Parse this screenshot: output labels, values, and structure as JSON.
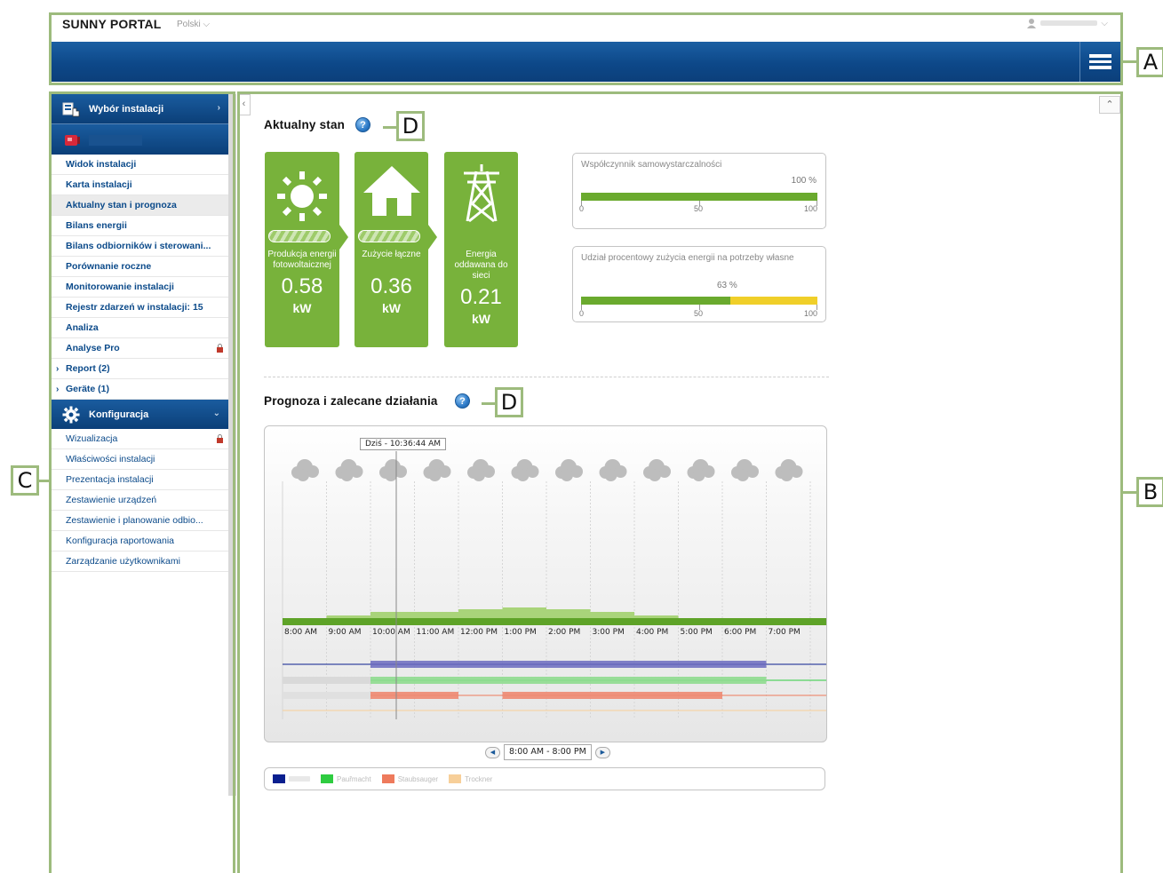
{
  "header": {
    "brand": "SUNNY PORTAL",
    "language": "Polski ⌵",
    "user_chevron": "⌵",
    "menu_icon": "list-menu-icon"
  },
  "sidebar": {
    "plant_selection": "Wybór instalacji",
    "items": [
      {
        "label": "Widok instalacji"
      },
      {
        "label": "Karta instalacji"
      },
      {
        "label": "Aktualny stan i prognoza"
      },
      {
        "label": "Bilans energii"
      },
      {
        "label": "Bilans odbiorników i sterowani..."
      },
      {
        "label": "Porównanie roczne"
      },
      {
        "label": "Monitorowanie instalacji"
      },
      {
        "label": "Rejestr zdarzeń w instalacji: 15"
      },
      {
        "label": "Analiza"
      },
      {
        "label": "Analyse Pro"
      }
    ],
    "expandables": [
      {
        "label": "Report (2)"
      },
      {
        "label": "Geräte (1)"
      }
    ],
    "config_title": "Konfiguracja",
    "config_items": [
      {
        "label": "Wizualizacja"
      },
      {
        "label": "Właściwości instalacji"
      },
      {
        "label": "Prezentacja instalacji"
      },
      {
        "label": "Zestawienie urządzeń"
      },
      {
        "label": "Zestawienie i planowanie odbio..."
      },
      {
        "label": "Konfiguracja raportowania"
      },
      {
        "label": "Zarządzanie użytkownikami"
      }
    ]
  },
  "current_status": {
    "title": "Aktualny stan",
    "tiles": [
      {
        "label": "Produkcja energii fotowoltaicznej",
        "value": "0.58",
        "unit": "kW",
        "icon": "sun-icon"
      },
      {
        "label": "Zużycie łączne",
        "value": "0.36",
        "unit": "kW",
        "icon": "house-icon"
      },
      {
        "label": "Energia oddawana do sieci",
        "value": "0.21",
        "unit": "kW",
        "icon": "power-pylon-icon"
      }
    ],
    "gauges": [
      {
        "title": "Współczynnik samowystarczalności",
        "percent_label": "100 %",
        "green_fraction": 1.0,
        "ticks": [
          "0",
          "50",
          "100"
        ]
      },
      {
        "title": "Udział procentowy zużycia energii na potrzeby własne",
        "percent_label": "63 %",
        "green_fraction": 0.63,
        "ticks": [
          "0",
          "50",
          "100"
        ]
      }
    ]
  },
  "forecast": {
    "title": "Prognoza i zalecane działania",
    "now_label": "Dziś - 10:36:44 AM",
    "hours": [
      "8:00 AM",
      "9:00 AM",
      "10:00 AM",
      "11:00 AM",
      "12:00 PM",
      "1:00 PM",
      "2:00 PM",
      "3:00 PM",
      "4:00 PM",
      "5:00 PM",
      "6:00 PM",
      "7:00 PM"
    ],
    "range": "8:00 AM - 8:00 PM",
    "legend_items": [
      {
        "color": "#0a1f8f"
      },
      {
        "color": "#2ecc40",
        "text": "Pauřmacht"
      },
      {
        "color": "#ee7a5c",
        "text": "Staubsauger"
      },
      {
        "color": "#f7cf99",
        "text": "Trockner"
      }
    ]
  },
  "callouts": {
    "a": "A",
    "b": "B",
    "c": "C",
    "d1": "D",
    "d2": "D"
  },
  "colors": {
    "header_blue": "#0d4889",
    "tile_green": "#78b23b",
    "gauge_green": "#6aaa2e",
    "gauge_yellow": "#f0cf29"
  }
}
